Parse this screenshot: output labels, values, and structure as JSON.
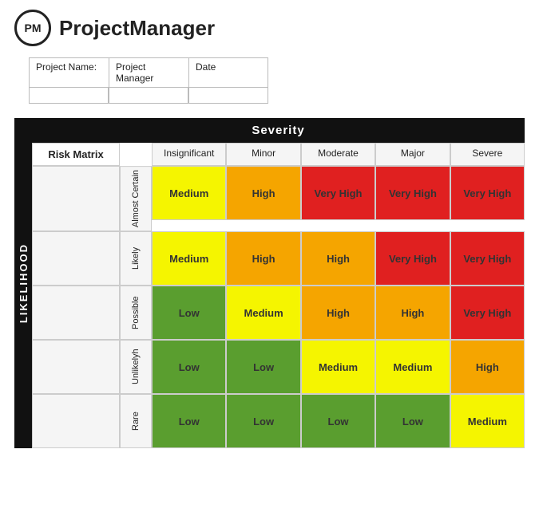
{
  "header": {
    "logo_text": "PM",
    "app_title": "ProjectManager"
  },
  "form": {
    "labels": [
      "Project Name:",
      "Project Manager",
      "Date"
    ],
    "input_placeholders": [
      "",
      "",
      ""
    ]
  },
  "matrix": {
    "likelihood_label": "Likelihood",
    "severity_label": "Severity",
    "risk_matrix_label": "Risk Matrix",
    "col_headers": [
      "Insignificant",
      "Minor",
      "Moderate",
      "Major",
      "Severe"
    ],
    "rows": [
      {
        "label": "Almost Certain",
        "cells": [
          {
            "value": "Medium",
            "class": "cell-medium"
          },
          {
            "value": "High",
            "class": "cell-high"
          },
          {
            "value": "Very High",
            "class": "cell-very-high"
          },
          {
            "value": "Very High",
            "class": "cell-very-high"
          },
          {
            "value": "Very High",
            "class": "cell-very-high"
          }
        ]
      },
      {
        "label": "Likely",
        "cells": [
          {
            "value": "Medium",
            "class": "cell-medium"
          },
          {
            "value": "High",
            "class": "cell-high"
          },
          {
            "value": "High",
            "class": "cell-high"
          },
          {
            "value": "Very High",
            "class": "cell-very-high"
          },
          {
            "value": "Very High",
            "class": "cell-very-high"
          }
        ]
      },
      {
        "label": "Possible",
        "cells": [
          {
            "value": "Low",
            "class": "cell-low"
          },
          {
            "value": "Medium",
            "class": "cell-medium"
          },
          {
            "value": "High",
            "class": "cell-high"
          },
          {
            "value": "High",
            "class": "cell-high"
          },
          {
            "value": "Very High",
            "class": "cell-very-high"
          }
        ]
      },
      {
        "label": "Unlikelyh",
        "cells": [
          {
            "value": "Low",
            "class": "cell-low"
          },
          {
            "value": "Low",
            "class": "cell-low"
          },
          {
            "value": "Medium",
            "class": "cell-medium"
          },
          {
            "value": "Medium",
            "class": "cell-medium"
          },
          {
            "value": "High",
            "class": "cell-high"
          }
        ]
      },
      {
        "label": "Rare",
        "cells": [
          {
            "value": "Low",
            "class": "cell-low"
          },
          {
            "value": "Low",
            "class": "cell-low"
          },
          {
            "value": "Low",
            "class": "cell-low"
          },
          {
            "value": "Low",
            "class": "cell-low"
          },
          {
            "value": "Medium",
            "class": "cell-medium"
          }
        ]
      }
    ]
  }
}
